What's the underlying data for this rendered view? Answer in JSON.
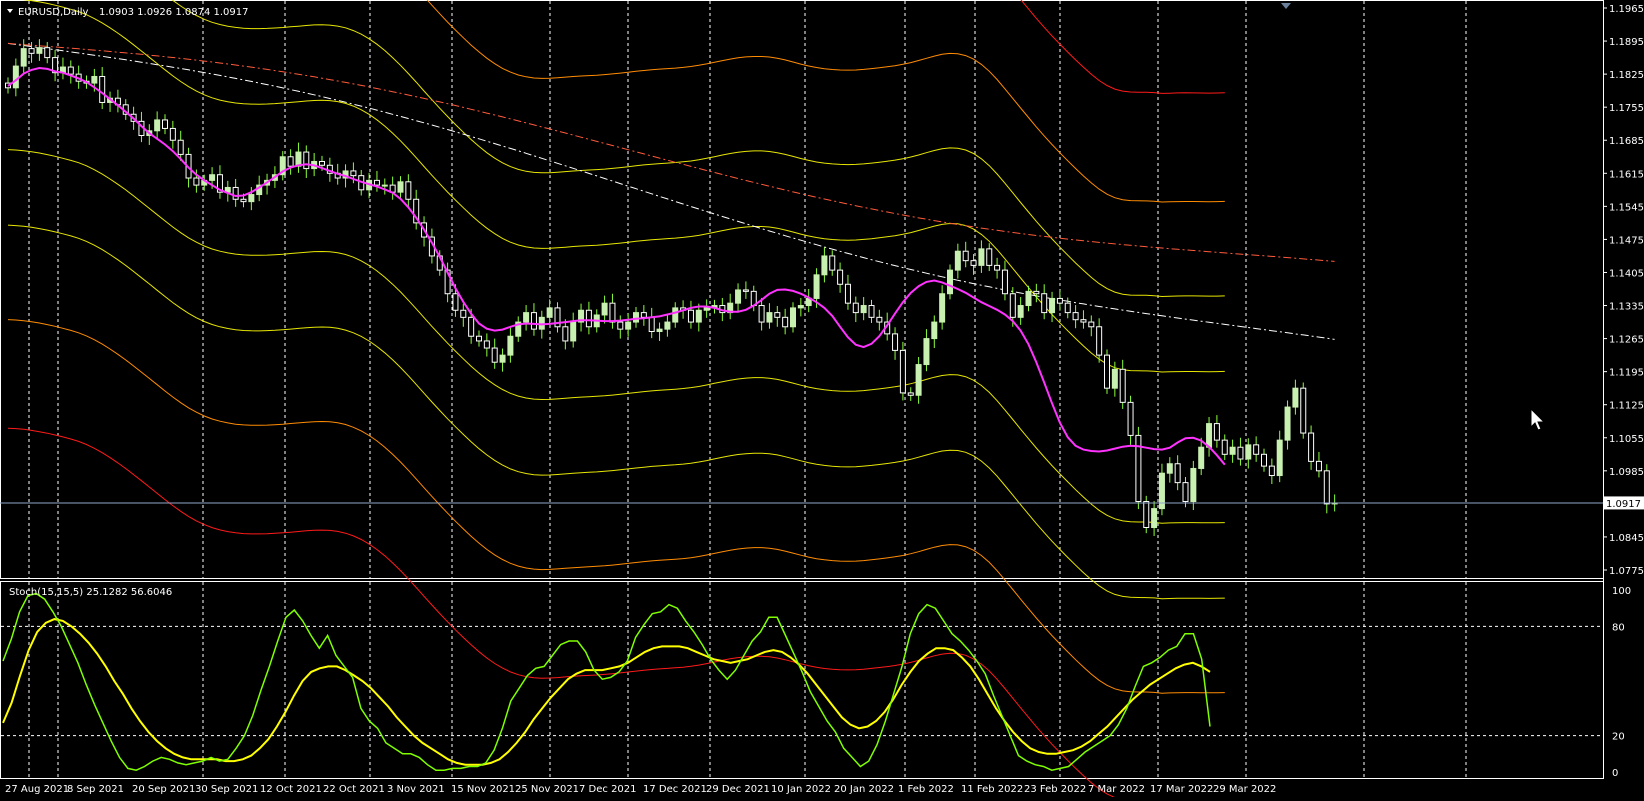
{
  "chart_data": [
    {
      "type": "line",
      "title": "EURUSD,Daily",
      "ohlc_text": "1.0903 1.0926 1.0874 1.0917",
      "symbol": "EURUSD",
      "timeframe": "Daily",
      "last_price": 1.0917,
      "last_price_label": "1.0917",
      "ylim": [
        1.0775,
        1.1965
      ],
      "y_ticks": [
        "1.1965",
        "1.1895",
        "1.1825",
        "1.1755",
        "1.1685",
        "1.1615",
        "1.1545",
        "1.1475",
        "1.1405",
        "1.1335",
        "1.1265",
        "1.1195",
        "1.1125",
        "1.1055",
        "1.0985",
        "1.0917",
        "1.0845",
        "1.0775"
      ],
      "x_ticks": [
        "27 Aug 2021",
        "8 Sep 2021",
        "20 Sep 2021",
        "30 Sep 2021",
        "12 Oct 2021",
        "22 Oct 2021",
        "3 Nov 2021",
        "15 Nov 2021",
        "25 Nov 2021",
        "7 Dec 2021",
        "17 Dec 2021",
        "29 Dec 2021",
        "10 Jan 2022",
        "20 Jan 2022",
        "1 Feb 2022",
        "11 Feb 2022",
        "23 Feb 2022",
        "7 Mar 2022",
        "17 Mar 2022",
        "29 Mar 2022"
      ],
      "grid": "vertical dashed",
      "colors": {
        "up": "#c8f0b0",
        "down": "#ffffff",
        "wick": "#8cff3c",
        "ma_fast": "#ff33ff",
        "band_inner": "#e6e600",
        "band_mid": "#ff8c00",
        "band_outer": "#ff1a1a",
        "long_ma": "#ffffff",
        "long_ma2": "#ff5a3c",
        "price_line": "#8fa6c8"
      },
      "close": [
        1.1796,
        1.1842,
        1.1879,
        1.1869,
        1.1881,
        1.186,
        1.1828,
        1.184,
        1.1825,
        1.181,
        1.1806,
        1.182,
        1.1765,
        1.1774,
        1.176,
        1.174,
        1.1725,
        1.1695,
        1.1705,
        1.1728,
        1.171,
        1.1685,
        1.1655,
        1.1605,
        1.159,
        1.16,
        1.1612,
        1.1575,
        1.1585,
        1.156,
        1.1555,
        1.157,
        1.159,
        1.16,
        1.1612,
        1.165,
        1.163,
        1.166,
        1.1625,
        1.164,
        1.1632,
        1.1615,
        1.1605,
        1.162,
        1.161,
        1.158,
        1.16,
        1.159,
        1.159,
        1.1575,
        1.1597,
        1.156,
        1.151,
        1.148,
        1.144,
        1.141,
        1.136,
        1.1325,
        1.131,
        1.127,
        1.126,
        1.1245,
        1.1215,
        1.123,
        1.127,
        1.13,
        1.132,
        1.1285,
        1.131,
        1.133,
        1.129,
        1.126,
        1.13,
        1.1325,
        1.129,
        1.1315,
        1.134,
        1.13,
        1.1285,
        1.13,
        1.132,
        1.131,
        1.128,
        1.1285,
        1.13,
        1.133,
        1.1325,
        1.13,
        1.1325,
        1.133,
        1.1335,
        1.132,
        1.134,
        1.1368,
        1.1365,
        1.1335,
        1.13,
        1.132,
        1.131,
        1.129,
        1.133,
        1.1335,
        1.135,
        1.14,
        1.144,
        1.141,
        1.138,
        1.134,
        1.132,
        1.1335,
        1.131,
        1.13,
        1.1275,
        1.124,
        1.115,
        1.1145,
        1.121,
        1.1265,
        1.13,
        1.136,
        1.141,
        1.145,
        1.143,
        1.142,
        1.1455,
        1.142,
        1.141,
        1.136,
        1.131,
        1.1335,
        1.1365,
        1.136,
        1.132,
        1.135,
        1.134,
        1.132,
        1.1305,
        1.13,
        1.129,
        1.123,
        1.116,
        1.12,
        1.113,
        1.106,
        1.092,
        1.0865,
        1.0905,
        1.098,
        1.1,
        1.096,
        1.092,
        1.099,
        1.1035,
        1.1085,
        1.105,
        1.102,
        1.1035,
        1.101,
        1.104,
        1.102,
        1.0995,
        1.0975,
        1.105,
        1.112,
        1.116,
        1.1065,
        1.1005,
        1.0985,
        1.0915,
        1.0917
      ],
      "fast_ma": [
        1.18,
        1.1812,
        1.1826,
        1.1834,
        1.1838,
        1.1836,
        1.1831,
        1.1828,
        1.1822,
        1.1816,
        1.1808,
        1.1797,
        1.1785,
        1.1772,
        1.1759,
        1.1745,
        1.1731,
        1.1715,
        1.17,
        1.1688,
        1.1676,
        1.1662,
        1.1645,
        1.1627,
        1.1612,
        1.16,
        1.159,
        1.158,
        1.1573,
        1.1567,
        1.1568,
        1.1575,
        1.1585,
        1.1596,
        1.1607,
        1.1619,
        1.1627,
        1.1632,
        1.1634,
        1.1632,
        1.1626,
        1.162,
        1.1614,
        1.1609,
        1.1603,
        1.1597,
        1.1592,
        1.1587,
        1.1581,
        1.1574,
        1.1561,
        1.1543,
        1.1521,
        1.1496,
        1.1468,
        1.1438,
        1.1405,
        1.1372,
        1.1343,
        1.1318,
        1.1297,
        1.1286,
        1.1282,
        1.1284,
        1.129,
        1.1295,
        1.1297,
        1.1296,
        1.1295,
        1.1296,
        1.1298,
        1.13,
        1.1302,
        1.1304,
        1.1304,
        1.1303,
        1.1302,
        1.1302,
        1.1303,
        1.1305,
        1.1307,
        1.1308,
        1.131,
        1.1312,
        1.1316,
        1.132,
        1.1325,
        1.133,
        1.1333,
        1.1333,
        1.133,
        1.1325,
        1.1322,
        1.1322,
        1.1326,
        1.1335,
        1.1347,
        1.136,
        1.1368,
        1.1369,
        1.1366,
        1.136,
        1.1352,
        1.1342,
        1.133,
        1.1313,
        1.129,
        1.1268,
        1.1252,
        1.1247,
        1.1254,
        1.127,
        1.1293,
        1.1318,
        1.1342,
        1.1362,
        1.1376,
        1.1385,
        1.1388,
        1.1384,
        1.1377,
        1.137,
        1.1362,
        1.1352,
        1.1342,
        1.1334,
        1.1326,
        1.1316,
        1.1302,
        1.1282,
        1.1253,
        1.1215,
        1.1172,
        1.1128,
        1.1087,
        1.1056,
        1.1038,
        1.103,
        1.1027,
        1.1026,
        1.1028,
        1.1032,
        1.1036,
        1.1038,
        1.1037,
        1.1034,
        1.1031,
        1.103,
        1.1034,
        1.1045,
        1.1054,
        1.1055,
        1.1049,
        1.1036,
        1.1018,
        1.0998
      ]
    },
    {
      "type": "line",
      "title": "Stoch(15,15,5) 25.1282 56.6046",
      "ylim": [
        0,
        100
      ],
      "y_ticks": [
        "100",
        "80",
        "20",
        "0"
      ],
      "levels": [
        20,
        80
      ],
      "grid": "vertical dashed",
      "colors": {
        "main": "#7fff00",
        "signal": "#ffff00"
      },
      "series": [
        {
          "values": [
            61,
            73,
            88,
            97,
            98,
            95,
            88,
            80,
            70,
            60,
            48,
            37,
            27,
            17,
            8,
            2,
            1,
            3,
            6,
            8,
            7,
            5,
            4,
            5,
            6,
            8,
            6,
            7,
            13,
            20,
            31,
            45,
            58,
            72,
            85,
            89,
            83,
            75,
            68,
            75,
            64,
            58,
            52,
            35,
            28,
            24,
            16,
            13,
            10,
            10,
            8,
            4,
            1,
            1,
            2,
            2,
            3,
            3,
            5,
            12,
            24,
            39,
            46,
            53,
            57,
            58,
            64,
            70,
            72,
            72,
            66,
            56,
            51,
            52,
            55,
            61,
            74,
            81,
            87,
            88,
            92,
            90,
            83,
            77,
            70,
            62,
            56,
            51,
            56,
            64,
            72,
            77,
            85,
            85,
            75,
            65,
            55,
            44,
            36,
            28,
            22,
            13,
            8,
            3,
            6,
            15,
            28,
            43,
            58,
            76,
            87,
            92,
            90,
            83,
            76,
            72,
            67,
            61,
            54,
            42,
            31,
            20,
            9,
            6,
            4,
            3,
            1,
            2,
            3,
            7,
            11,
            14,
            17,
            20,
            26,
            35,
            47,
            58,
            60,
            63,
            67,
            69,
            76,
            76,
            62,
            25
          ]
        },
        {
          "values": [
            27,
            38,
            53,
            67,
            77,
            82,
            84,
            83,
            80,
            76,
            71,
            65,
            58,
            50,
            43,
            35,
            28,
            22,
            17,
            13,
            10,
            8,
            7,
            7,
            7,
            7,
            6,
            6,
            7,
            9,
            13,
            18,
            25,
            33,
            42,
            50,
            55,
            57,
            58,
            58,
            56,
            53,
            50,
            46,
            41,
            36,
            30,
            25,
            20,
            16,
            13,
            10,
            7,
            5,
            4,
            4,
            4,
            5,
            7,
            11,
            16,
            22,
            29,
            35,
            41,
            46,
            51,
            54,
            56,
            56,
            56,
            57,
            58,
            60,
            63,
            66,
            68,
            69,
            69,
            69,
            68,
            66,
            64,
            62,
            61,
            60,
            61,
            62,
            64,
            66,
            67,
            66,
            63,
            59,
            54,
            48,
            42,
            36,
            30,
            26,
            24,
            25,
            28,
            33,
            40,
            48,
            55,
            61,
            65,
            68,
            68,
            67,
            63,
            58,
            51,
            43,
            35,
            28,
            22,
            17,
            13,
            11,
            10,
            10,
            11,
            12,
            14,
            17,
            21,
            25,
            30,
            35,
            40,
            44,
            48,
            51,
            54,
            57,
            59,
            60,
            58,
            55
          ]
        }
      ]
    }
  ]
}
